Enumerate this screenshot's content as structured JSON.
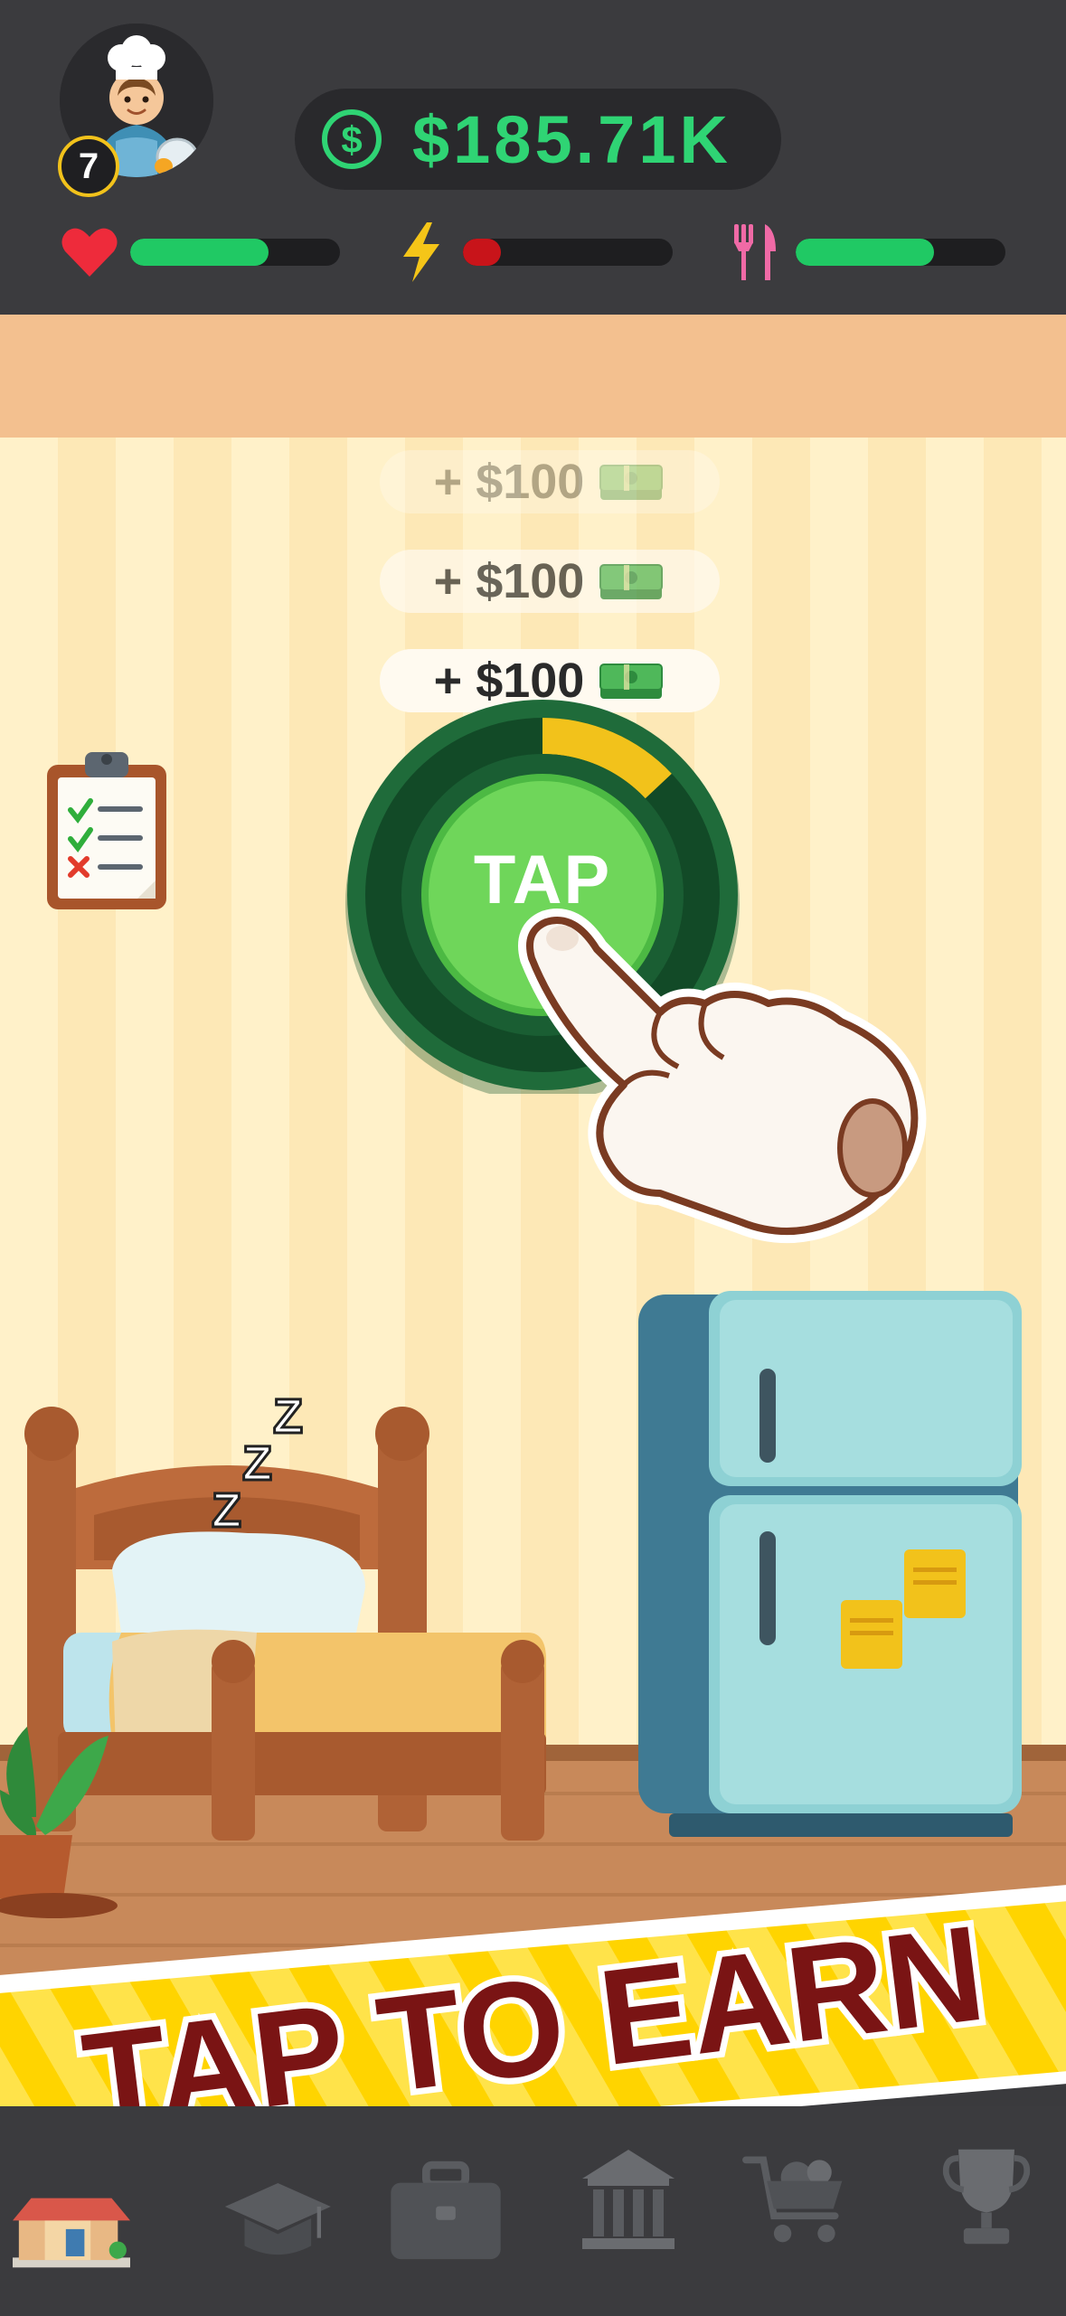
{
  "header": {
    "level": "7",
    "money": "$185.71K",
    "stats": {
      "health": {
        "icon": "heart-icon",
        "fill": 0.66,
        "color": "#20c964"
      },
      "energy": {
        "icon": "lightning-icon",
        "fill": 0.18,
        "color": "#c8141a"
      },
      "food": {
        "icon": "fork-knife-icon",
        "fill": 0.66,
        "color": "#20c964"
      }
    }
  },
  "rewards": [
    {
      "label": "+ $100"
    },
    {
      "label": "+ $100"
    },
    {
      "label": "+ $100"
    }
  ],
  "tap_button": {
    "label": "TAP",
    "progress": 0.13
  },
  "sleep_text": [
    "Z",
    "Z",
    "Z"
  ],
  "banner": {
    "text": "TAP TO EARN"
  },
  "nav": {
    "items": [
      {
        "name": "home",
        "icon": "house-icon"
      },
      {
        "name": "education",
        "icon": "graduation-cap-icon"
      },
      {
        "name": "job",
        "icon": "briefcase-icon"
      },
      {
        "name": "bank",
        "icon": "bank-icon"
      },
      {
        "name": "shop",
        "icon": "shopping-cart-icon"
      },
      {
        "name": "achievements",
        "icon": "trophy-icon"
      }
    ]
  },
  "colors": {
    "money": "#2fd474",
    "tap_outer": "#1f6b3a",
    "tap_inner": "#6fd65a",
    "banner_yellow": "#ffd400",
    "banner_text": "#7a1414"
  }
}
